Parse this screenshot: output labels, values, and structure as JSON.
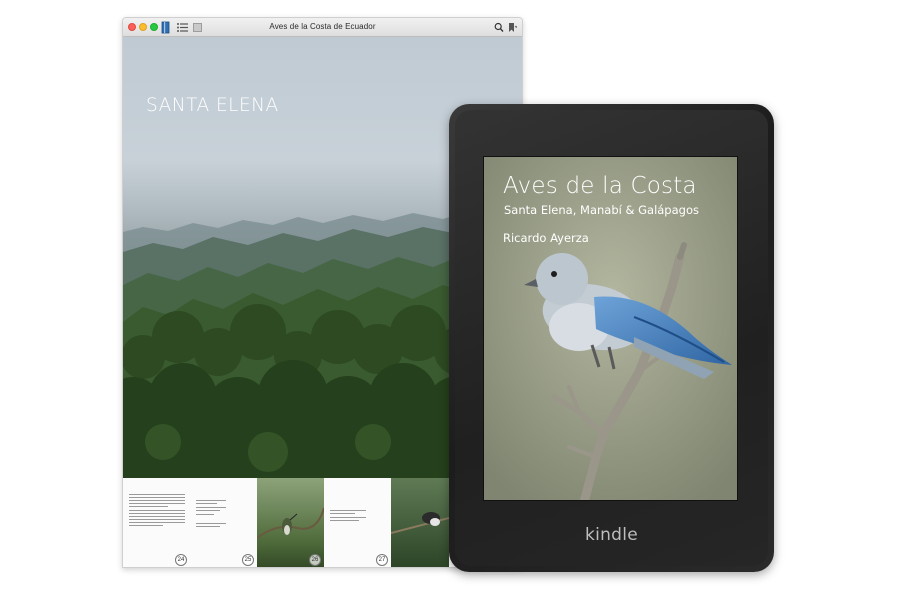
{
  "reader_window": {
    "title": "Aves de la Costa de Ecuador",
    "chapter_title": "SANTA ELENA",
    "page_numbers": [
      "24",
      "25",
      "26",
      "27"
    ]
  },
  "kindle": {
    "book_title": "Aves de la Costa",
    "book_subtitle": "Santa Elena, Manabí & Galápagos",
    "author": "Ricardo Ayerza",
    "brand": "kindle"
  },
  "icons": [
    "close-button",
    "minimize-button",
    "maximize-button",
    "library-icon",
    "table-of-contents-icon",
    "view-icon",
    "search-icon",
    "bookmark-icon"
  ],
  "colors": {
    "close": "#fc5f57",
    "minimize": "#fdbc2e",
    "maximize": "#28c840",
    "device": "#1f1f1f",
    "bird_blue": "#3f79b6"
  }
}
